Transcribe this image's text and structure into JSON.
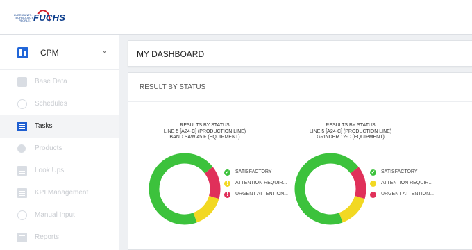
{
  "brand": {
    "name": "FUCHS",
    "tagline": "LUBRICANTS. TECHNOLOGY. PEOPLE.",
    "blue": "#0b3d8c",
    "red": "#d11f2c"
  },
  "sidebar": {
    "module": {
      "label": "CPM",
      "icon": "module-icon",
      "chevron": "chevron-down-icon"
    },
    "items": [
      {
        "label": "Base Data",
        "icon": "building-icon",
        "active": false
      },
      {
        "label": "Schedules",
        "icon": "clock-icon",
        "active": false
      },
      {
        "label": "Tasks",
        "icon": "clipboard-icon",
        "active": true
      },
      {
        "label": "Products",
        "icon": "drop-icon",
        "active": false
      },
      {
        "label": "Look Ups",
        "icon": "clipboard-icon",
        "active": false
      },
      {
        "label": "KPI Management",
        "icon": "document-icon",
        "active": false
      },
      {
        "label": "Manual Input",
        "icon": "clock-icon",
        "active": false
      },
      {
        "label": "Reports",
        "icon": "document-icon",
        "active": false
      }
    ]
  },
  "page": {
    "title": "MY DASHBOARD",
    "section_title": "RESULT BY STATUS"
  },
  "colors": {
    "satisfactory": "#3cc23c",
    "attention": "#f2d822",
    "urgent": "#e0305a",
    "accent": "#2166d8"
  },
  "charts": [
    {
      "title_lines": [
        "RESULTS BY STATUS",
        "LINE 5 [A24-C] (PRODUCTION LINE)",
        "BAND SAW 45 F (EQUIPMENT)"
      ],
      "legend": [
        {
          "label": "SATISFACTORY",
          "symbol": "✓"
        },
        {
          "label": "ATTENTION REQUIR...",
          "symbol": "!"
        },
        {
          "label": "URGENT ATTENTION...",
          "symbol": "!"
        }
      ]
    },
    {
      "title_lines": [
        "RESULTS BY STATUS",
        "LINE 5 [A24-C] (PRODUCTION LINE)",
        "GRINDER 12-C (EQUIPMENT)"
      ],
      "legend": [
        {
          "label": "SATISFACTORY",
          "symbol": "✓"
        },
        {
          "label": "ATTENTION REQUIR...",
          "symbol": "!"
        },
        {
          "label": "URGENT ATTENTION...",
          "symbol": "!"
        }
      ]
    }
  ],
  "chart_data": [
    {
      "type": "pie",
      "categories": [
        "SATISFACTORY",
        "ATTENTION REQUIR...",
        "URGENT ATTENTION..."
      ],
      "values": [
        70,
        15,
        15
      ],
      "title": "RESULTS BY STATUS"
    },
    {
      "type": "pie",
      "categories": [
        "SATISFACTORY",
        "ATTENTION REQUIR...",
        "URGENT ATTENTION..."
      ],
      "values": [
        70,
        15,
        15
      ],
      "title": "RESULTS BY STATUS"
    }
  ]
}
